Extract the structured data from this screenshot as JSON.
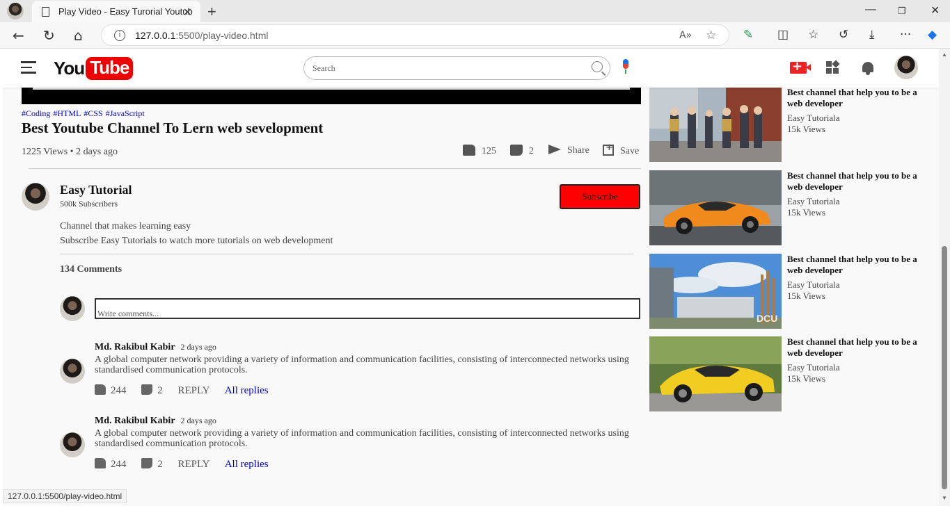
{
  "browser": {
    "tab_title": "Play Video - Easy Turorial Youtub",
    "url_host": "127.0.0.1",
    "url_rest": ":5500/play-video.html",
    "status_url": "127.0.0.1:5500/play-video.html"
  },
  "nav": {
    "logo_you": "You",
    "logo_tube": "Tube",
    "search_placeholder": "Search"
  },
  "video": {
    "tags": [
      "#Coding",
      "#HTML",
      "#CSS",
      "#JavaScript"
    ],
    "title": "Best Youtube Channel To Lern web sevelopment",
    "views": "1225 Views • 2 days ago",
    "likes": "125",
    "dislikes": "2",
    "share_label": "Share",
    "save_label": "Save"
  },
  "channel": {
    "name": "Easy Tutorial",
    "subscribers": "500k Subscribers",
    "subscribe_label": "Subscribe",
    "description": [
      "Channel that makes learning easy",
      "Subscribe Easy Tutorials to watch more tutorials on web development"
    ]
  },
  "comments": {
    "count_label": "134 Comments",
    "input_placeholder": "Write comments...",
    "items": [
      {
        "author": "Md. Rakibul Kabir",
        "time": "2 days ago",
        "text": "A global computer network providing a variety of information and communication facilities, consisting of interconnected networks using standardised communication protocols.",
        "likes": "244",
        "dislikes": "2",
        "reply_label": "REPLY",
        "all_replies_label": "All replies"
      },
      {
        "author": "Md. Rakibul Kabir",
        "time": "2 days ago",
        "text": "A global computer network providing a variety of information and communication facilities, consisting of interconnected networks using standardised communication protocols.",
        "likes": "244",
        "dislikes": "2",
        "reply_label": "REPLY",
        "all_replies_label": "All replies"
      }
    ]
  },
  "sidebar": {
    "items": [
      {
        "title": "Best channel that help you to be a web developer",
        "channel": "Easy Tutoriala",
        "views": "15k Views",
        "thumb": "students-walking"
      },
      {
        "title": "Best channel that help you to be a web developer",
        "channel": "Easy Tutoriala",
        "views": "15k Views",
        "thumb": "orange-car"
      },
      {
        "title": "Best channel that help you to be a web developer",
        "channel": "Easy Tutoriala",
        "views": "15k Views",
        "thumb": "campus-building"
      },
      {
        "title": "Best channel that help you to be a web developer",
        "channel": "Easy Tutoriala",
        "views": "15k Views",
        "thumb": "yellow-car"
      }
    ],
    "campus_sign": "DCU"
  },
  "colors": {
    "brand_red": "#ee0000",
    "subscribe_red": "#ff0000",
    "link_blue": "#0000cc"
  }
}
